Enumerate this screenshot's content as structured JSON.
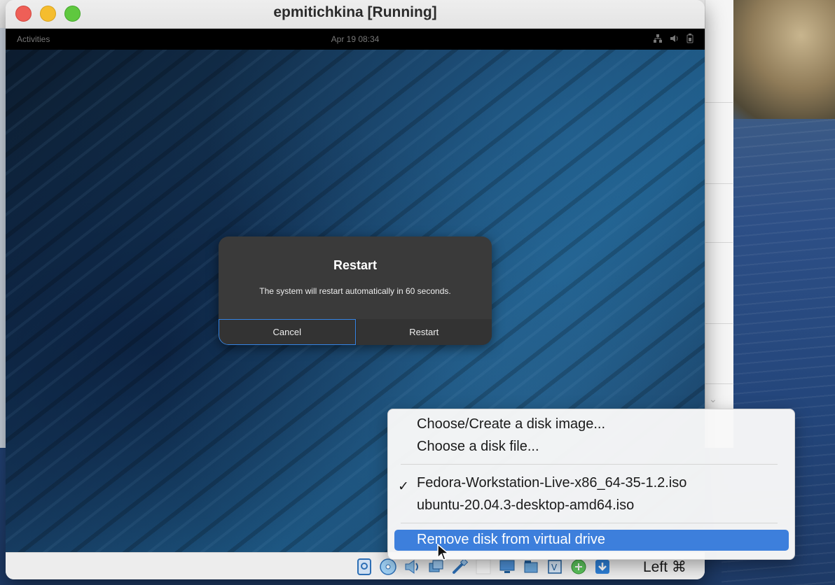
{
  "window": {
    "title": "epmitichkina [Running]"
  },
  "guest": {
    "top_bar": {
      "activities": "Activities",
      "clock": "Apr 19  08:34"
    },
    "dialog": {
      "title": "Restart",
      "message": "The system will restart automatically in 60 seconds.",
      "cancel_label": "Cancel",
      "restart_label": "Restart"
    }
  },
  "status_bar": {
    "host_key": "Left ⌘",
    "icons": [
      "hard-disk-icon",
      "optical-disk-icon",
      "audio-icon",
      "network-icon",
      "usb-icon",
      "shared-folder-icon",
      "display-icon",
      "recording-icon",
      "cpu-icon",
      "mouse-integration-icon",
      "keyboard-icon"
    ]
  },
  "context_menu": {
    "items": [
      {
        "label": "Choose/Create a disk image..."
      },
      {
        "label": "Choose a disk file..."
      },
      {
        "label": "Fedora-Workstation-Live-x86_64-35-1.2.iso",
        "checked": true
      },
      {
        "label": "ubuntu-20.04.3-desktop-amd64.iso",
        "checked": false
      },
      {
        "label": "Remove disk from virtual drive",
        "highlighted": true
      }
    ]
  },
  "colors": {
    "menu_highlight": "#3d7fdc",
    "dialog_focus": "#3584e4"
  }
}
